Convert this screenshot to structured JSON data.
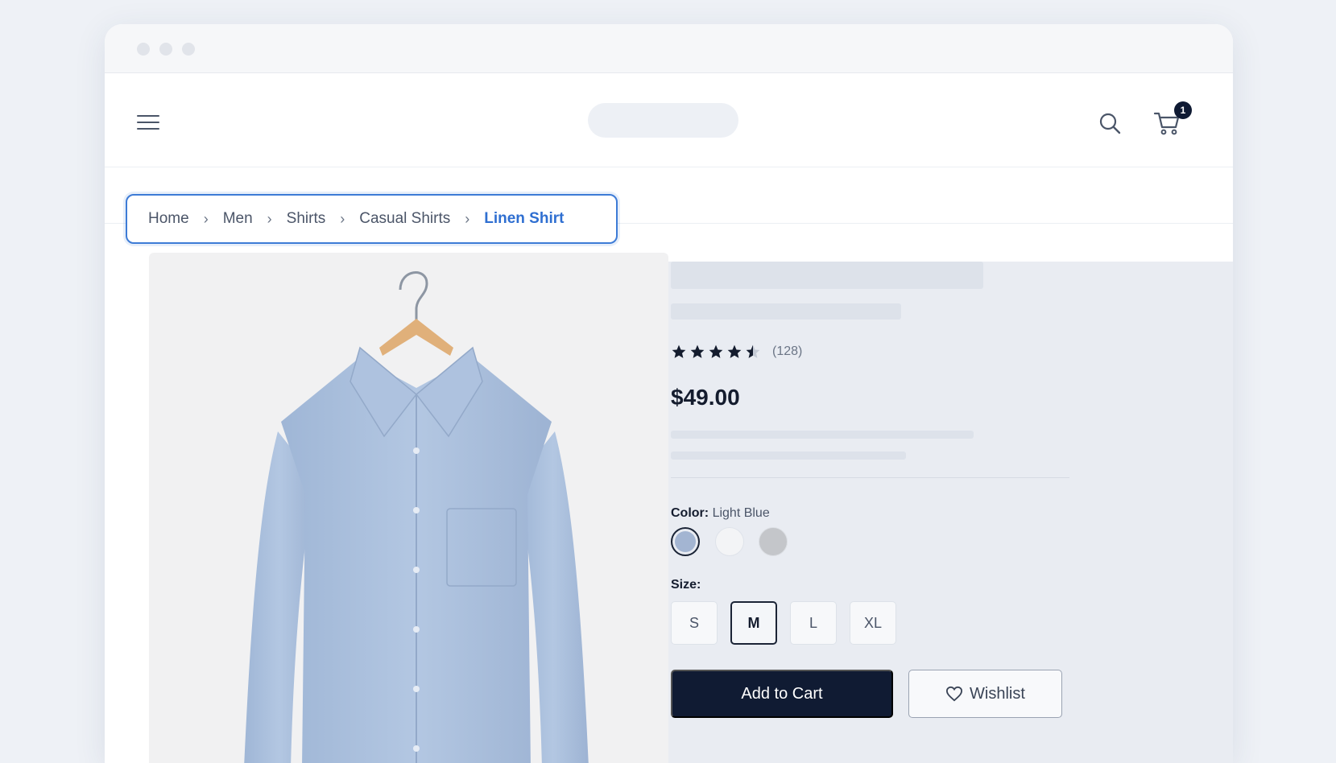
{
  "header": {
    "cart_count": "1"
  },
  "breadcrumb": {
    "items": [
      "Home",
      "Men",
      "Shirts",
      "Casual Shirts",
      "Linen Shirt"
    ]
  },
  "product": {
    "rating": {
      "value": 4.5,
      "max": 5,
      "reviews": "(128)"
    },
    "price": "$49.00",
    "color_label": "Color:",
    "color_value": "Light Blue",
    "size_label": "Size:",
    "sizes": [
      "S",
      "M",
      "L",
      "XL"
    ],
    "selected_size": "M",
    "add_to_cart": "Add to Cart",
    "wishlist": "Wishlist"
  },
  "colors": {
    "accent": "#2f6fd1",
    "primary_button": "#101b33",
    "swatch_selected": "#a3b5d2"
  }
}
